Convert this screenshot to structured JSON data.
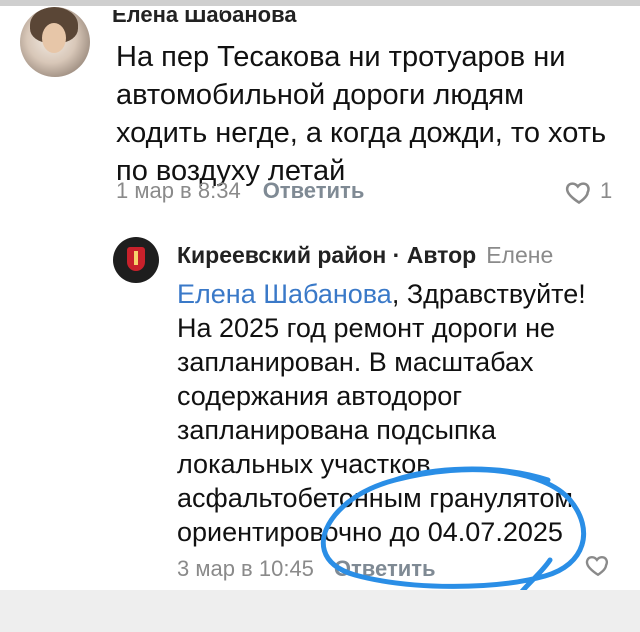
{
  "comment": {
    "author": "Елена Шабанова",
    "text": "На пер Тесакова ни тротуаров ни автомобильной дороги людям ходить негде, а когда дожди, то хоть по воздуху летай",
    "time": "1 мар в 8:34",
    "reply_label": "Ответить",
    "likes": "1"
  },
  "reply": {
    "author": "Киреевский район · Автор",
    "to": "Елене",
    "mention": "Елена Шабанова",
    "text": ", Здравствуйте! На 2025 год ремонт дороги не запланирован. В масштабах содержания автодорог запланирована подсыпка локальных участков асфальтобетонным гранулятом ориентировочно до 04.07.2025",
    "time": "3 мар в 10:45",
    "reply_label": "Ответить"
  },
  "colors": {
    "mention": "#3a79c8",
    "annotation": "#2a8ee6",
    "meta": "#8a8a8a"
  },
  "icons": {
    "like": "heart-icon",
    "avatar_community": "coat-of-arms-icon"
  }
}
